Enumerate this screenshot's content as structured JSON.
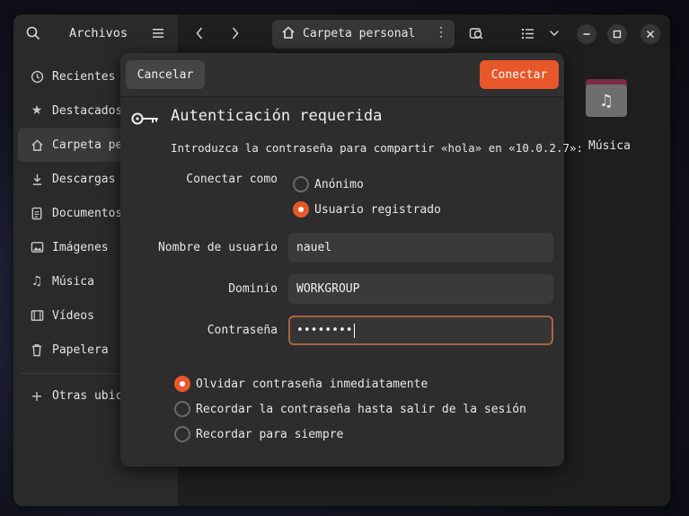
{
  "app": {
    "title": "Archivos"
  },
  "pathbar": {
    "location": "Carpeta personal"
  },
  "sidebar": {
    "items": [
      {
        "label": "Recientes",
        "icon": "clock-icon"
      },
      {
        "label": "Destacados",
        "icon": "star-icon"
      },
      {
        "label": "Carpeta personal",
        "icon": "home-icon",
        "active": true
      },
      {
        "label": "Descargas",
        "icon": "download-icon"
      },
      {
        "label": "Documentos",
        "icon": "document-icon"
      },
      {
        "label": "Imágenes",
        "icon": "image-icon"
      },
      {
        "label": "Música",
        "icon": "music-icon"
      },
      {
        "label": "Vídeos",
        "icon": "video-icon"
      },
      {
        "label": "Papelera",
        "icon": "trash-icon"
      }
    ],
    "other": {
      "label": "Otras ubicaciones",
      "icon": "plus-icon"
    }
  },
  "files": [
    {
      "label": "Música",
      "icon": "music-folder-icon"
    }
  ],
  "dialog": {
    "cancel_label": "Cancelar",
    "connect_label": "Conectar",
    "title": "Autenticación requerida",
    "message": "Introduzca la contraseña para compartir «hola» en «10.0.2.7»:",
    "connect_as_label": "Conectar como",
    "connect_as_options": [
      {
        "label": "Anónimo",
        "selected": false
      },
      {
        "label": "Usuario registrado",
        "selected": true
      }
    ],
    "username_label": "Nombre de usuario",
    "username_value": "nauel",
    "domain_label": "Dominio",
    "domain_value": "WORKGROUP",
    "password_label": "Contraseña",
    "password_mask": "••••••••",
    "remember_options": [
      {
        "label": "Olvidar contraseña inmediatamente",
        "selected": true
      },
      {
        "label": "Recordar la contraseña hasta salir de la sesión",
        "selected": false
      },
      {
        "label": "Recordar para siempre",
        "selected": false
      }
    ]
  },
  "colors": {
    "accent": "#e8572a",
    "window_bg": "#1e1e1e",
    "sidebar_bg": "#2a2a2a",
    "dialog_bg": "#2d2d2d"
  }
}
